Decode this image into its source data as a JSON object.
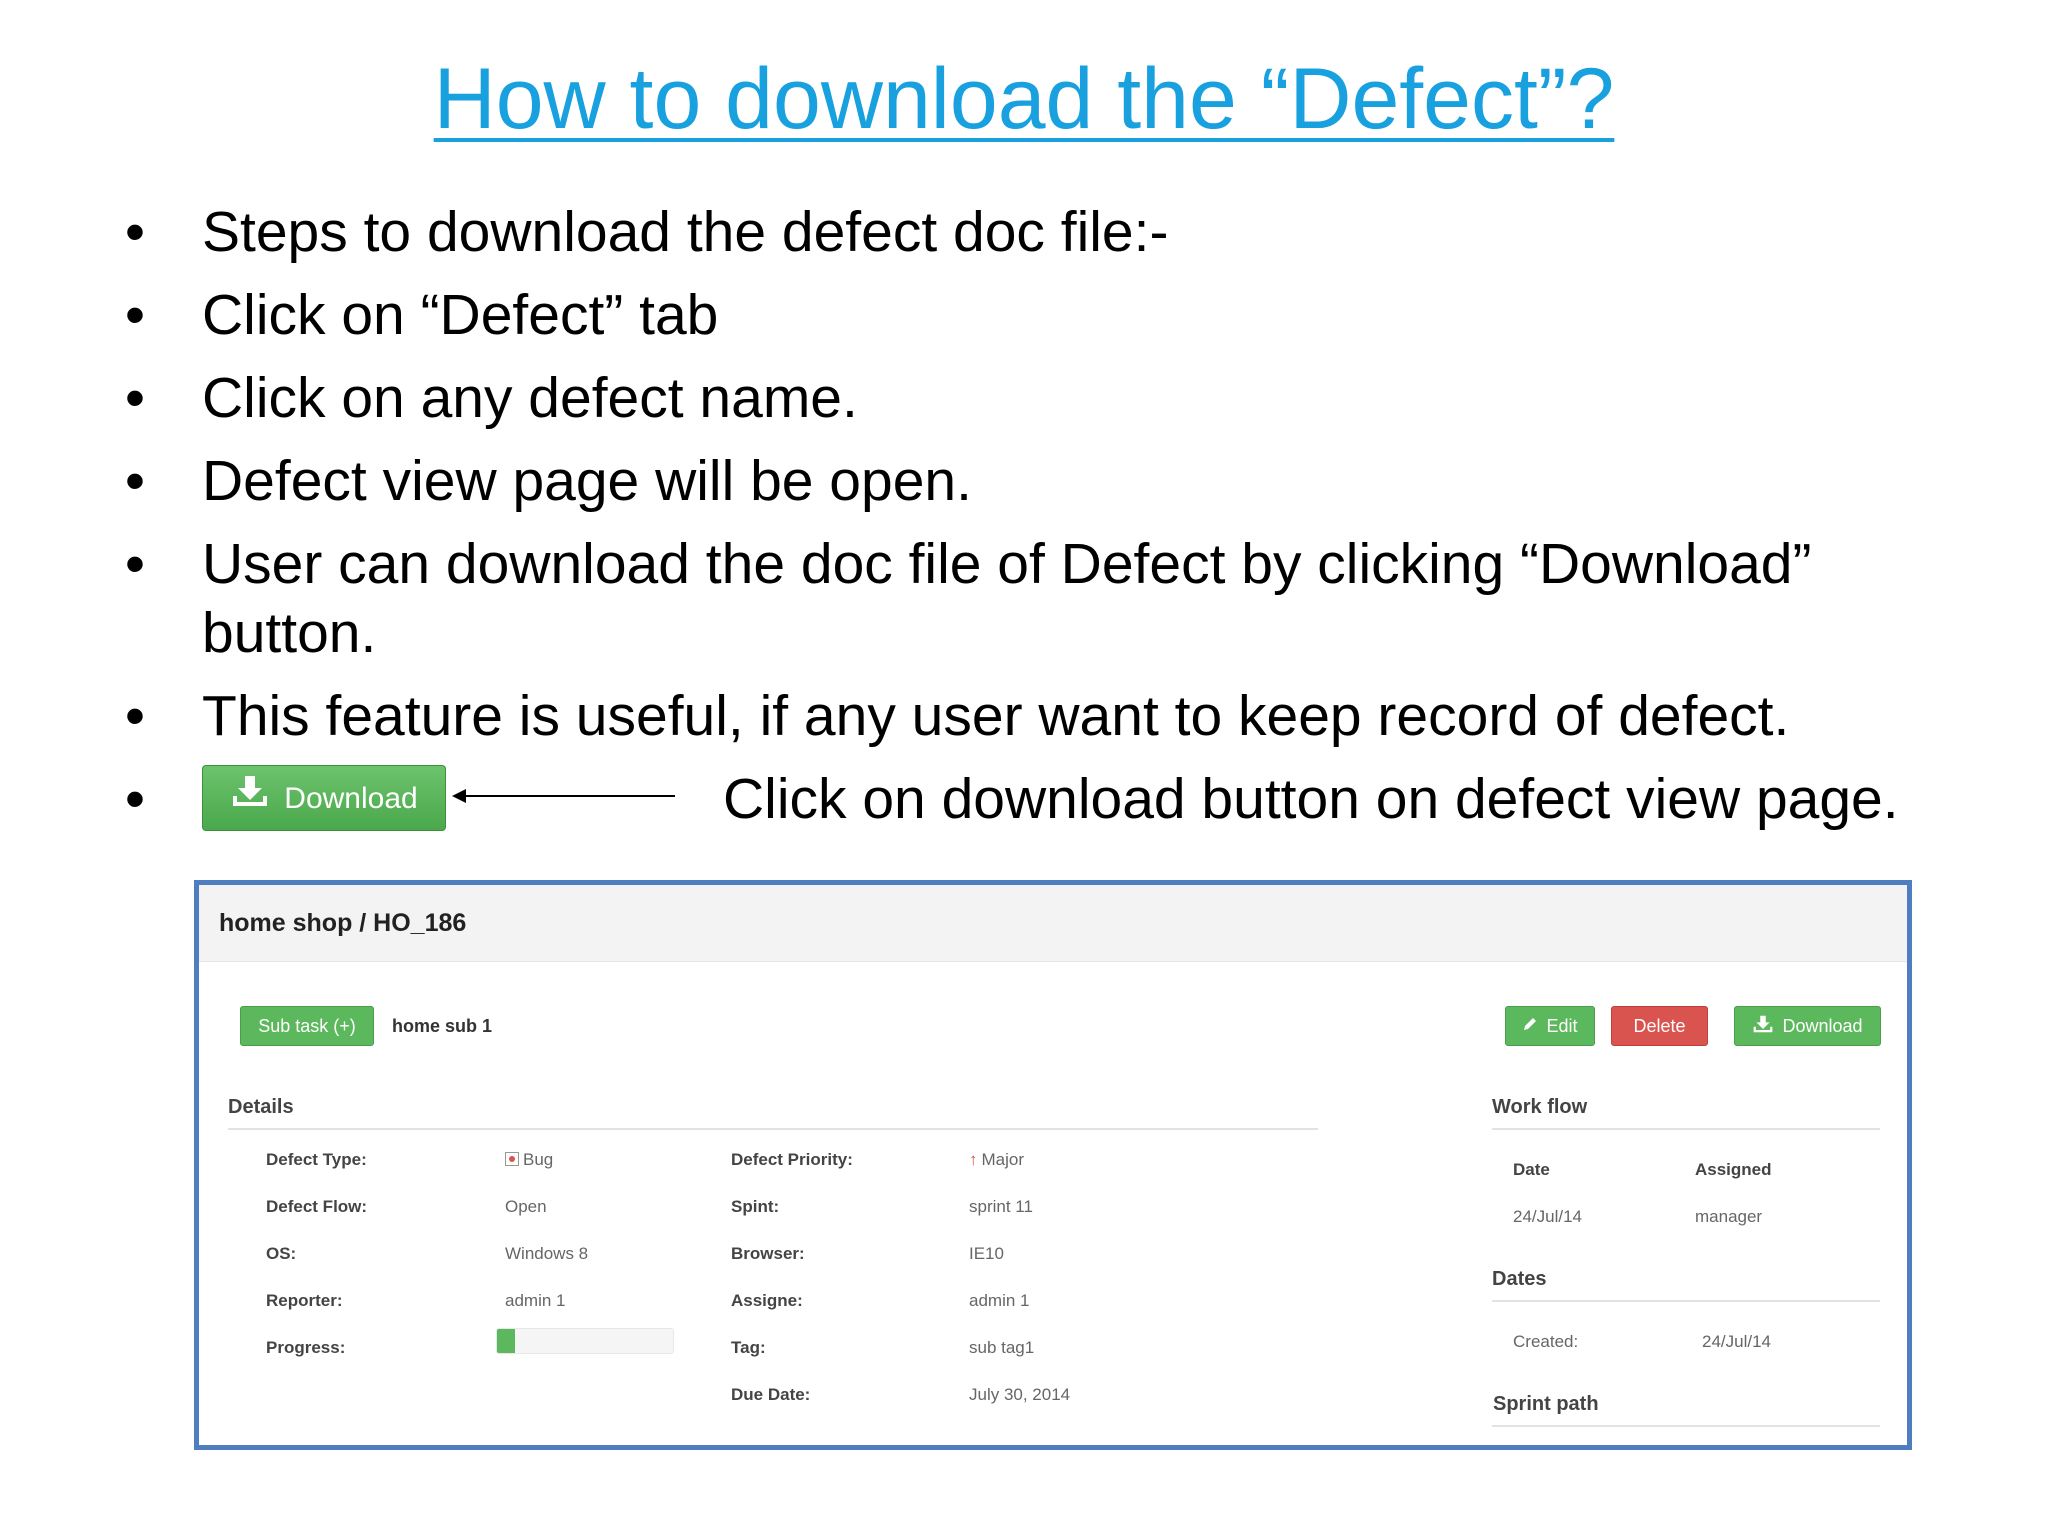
{
  "title": "How to download the “Defect”?",
  "bullets": [
    "Steps to download the defect doc file:-",
    "Click on “Defect” tab",
    "Click on any defect name.",
    "Defect view page will be open.",
    "User can download the doc file of Defect by clicking “Download” button.",
    "This feature is useful, if any user want to keep record of defect."
  ],
  "bullet_symbol": "•",
  "download_hint": {
    "button_label": "Download",
    "text": "Click on download button on defect view page."
  },
  "app": {
    "breadcrumb": "home shop / HO_186",
    "subtask_button": "Sub task (+)",
    "subtask_name": "home sub 1",
    "edit_button": "Edit",
    "delete_button": "Delete",
    "download_button": "Download",
    "details_heading": "Details",
    "details": {
      "defect_type_label": "Defect Type:",
      "defect_type_value": "Bug",
      "defect_flow_label": "Defect Flow:",
      "defect_flow_value": "Open",
      "os_label": "OS:",
      "os_value": "Windows 8",
      "reporter_label": "Reporter:",
      "reporter_value": "admin 1",
      "progress_label": "Progress:",
      "progress_fraction": 0.1,
      "priority_label": "Defect Priority:",
      "priority_value": "Major",
      "sprint_label": "Spint:",
      "sprint_value": "sprint 11",
      "browser_label": "Browser:",
      "browser_value": "IE10",
      "assignee_label": "Assigne:",
      "assignee_value": "admin 1",
      "tag_label": "Tag:",
      "tag_value": "sub tag1",
      "due_label": "Due Date:",
      "due_value": "July 30, 2014"
    },
    "workflow": {
      "heading": "Work flow",
      "col_date": "Date",
      "col_assigned": "Assigned",
      "row_date": "24/Jul/14",
      "row_assigned": "manager"
    },
    "dates": {
      "heading": "Dates",
      "created_label": "Created:",
      "created_value": "24/Jul/14"
    },
    "sprint_path_heading": "Sprint path"
  },
  "colors": {
    "title": "#18a0df",
    "green": "#5cb85c",
    "red": "#d9534f",
    "frame_border": "#4f7ec0"
  },
  "icons": [
    "download-icon",
    "pencil-icon",
    "bug-icon",
    "arrow-up-icon",
    "arrow-left-icon"
  ]
}
